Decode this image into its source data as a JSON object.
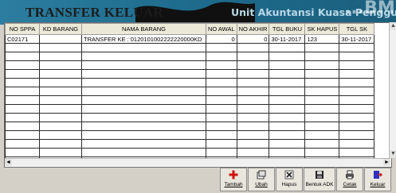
{
  "header": {
    "title": "TRANSFER KELUAR",
    "subtitle": "Unit Akuntansi Kuasa Penggun",
    "watermark": "...BM"
  },
  "table": {
    "columns": [
      "NO SPPA",
      "KD BARANG",
      "NAMA BARANG",
      "NO AWAL",
      "NO AKHIR",
      "TGL BUKU",
      "SK HAPUS",
      "TGL SK"
    ],
    "rows": [
      [
        "C02171",
        "",
        "TRANSFER KE : 0120101002222220000KD",
        "0",
        "0",
        "30-11-2017",
        "123",
        "30-11-2017"
      ]
    ],
    "empty_rows": 14
  },
  "scrollbars": {
    "up": "▲",
    "down": "▼",
    "left": "◄",
    "right": "►"
  },
  "toolbar": {
    "buttons": [
      {
        "label": "Tambah",
        "icon": "add-icon"
      },
      {
        "label": "Ubah",
        "icon": "edit-icon"
      },
      {
        "label": "Hapus",
        "icon": "delete-icon"
      },
      {
        "label": "Bentuk ADK",
        "icon": "save-icon"
      },
      {
        "label": "Cetak",
        "icon": "print-icon"
      },
      {
        "label": "Keluar",
        "icon": "exit-icon"
      }
    ]
  },
  "colors": {
    "banner": "#1e6c8e",
    "add_icon": "#d01010",
    "exit_icon": "#3030c0"
  }
}
